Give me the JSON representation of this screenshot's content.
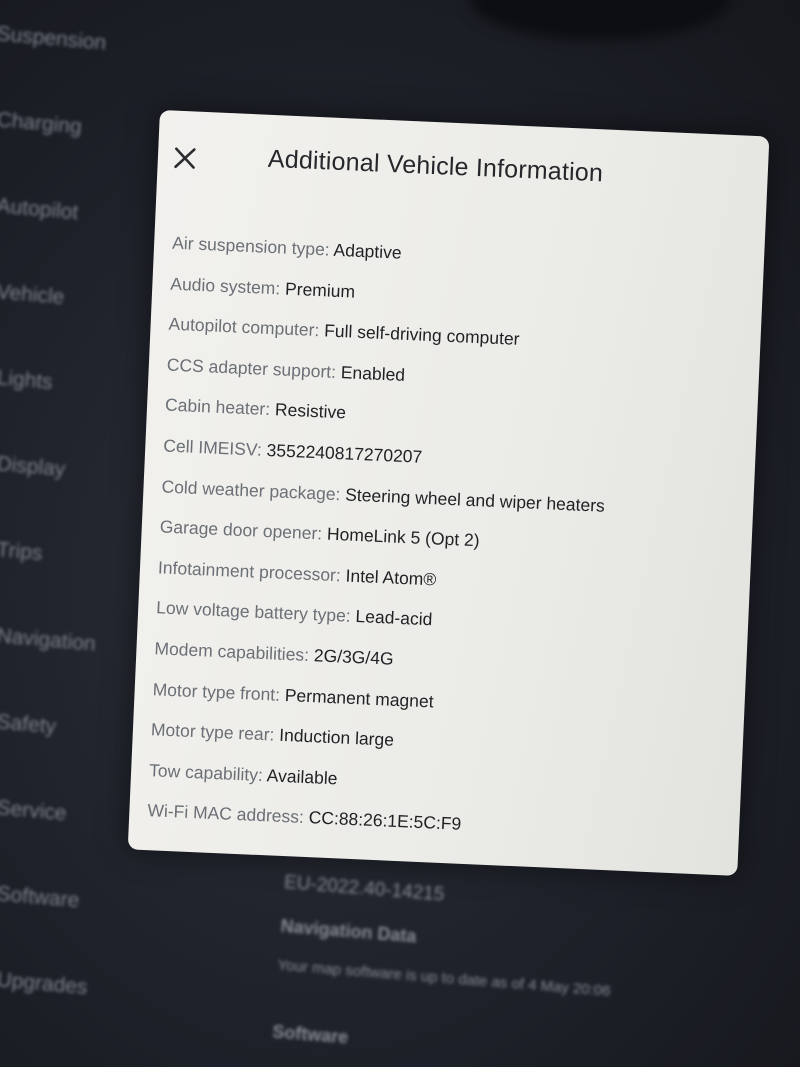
{
  "background": {
    "sidebar_items": [
      "Suspension",
      "Charging",
      "Autopilot",
      "Vehicle",
      "Lights",
      "Display",
      "Trips",
      "Navigation",
      "Safety",
      "Service",
      "Software",
      "Upgrades"
    ],
    "software_version": "EU-2022.40-14215",
    "navigation_data_title": "Navigation Data",
    "navigation_data_text": "Your map software is up to date as of 4 May 20:06",
    "software_title": "Software"
  },
  "modal": {
    "title": "Additional Vehicle Information",
    "close_icon": "close-icon",
    "rows": [
      {
        "label": "Air suspension type:",
        "value": "Adaptive"
      },
      {
        "label": "Audio system:",
        "value": "Premium"
      },
      {
        "label": "Autopilot computer:",
        "value": "Full self-driving computer"
      },
      {
        "label": "CCS adapter support:",
        "value": "Enabled"
      },
      {
        "label": "Cabin heater:",
        "value": "Resistive"
      },
      {
        "label": "Cell IMEISV:",
        "value": "3552240817270207"
      },
      {
        "label": "Cold weather package:",
        "value": "Steering wheel and wiper heaters"
      },
      {
        "label": "Garage door opener:",
        "value": "HomeLink 5 (Opt 2)"
      },
      {
        "label": "Infotainment processor:",
        "value": "Intel Atom®"
      },
      {
        "label": "Low voltage battery type:",
        "value": "Lead-acid"
      },
      {
        "label": "Modem capabilities:",
        "value": "2G/3G/4G"
      },
      {
        "label": "Motor type front:",
        "value": "Permanent magnet"
      },
      {
        "label": "Motor type rear:",
        "value": "Induction large"
      },
      {
        "label": "Tow capability:",
        "value": "Available"
      },
      {
        "label": "Wi-Fi MAC address:",
        "value": "CC:88:26:1E:5C:F9"
      }
    ]
  },
  "colors": {
    "modal_background": "#efeeeb",
    "screen_background": "#1f222a",
    "label_text": "#6b6f76",
    "value_text": "#1f2124"
  }
}
